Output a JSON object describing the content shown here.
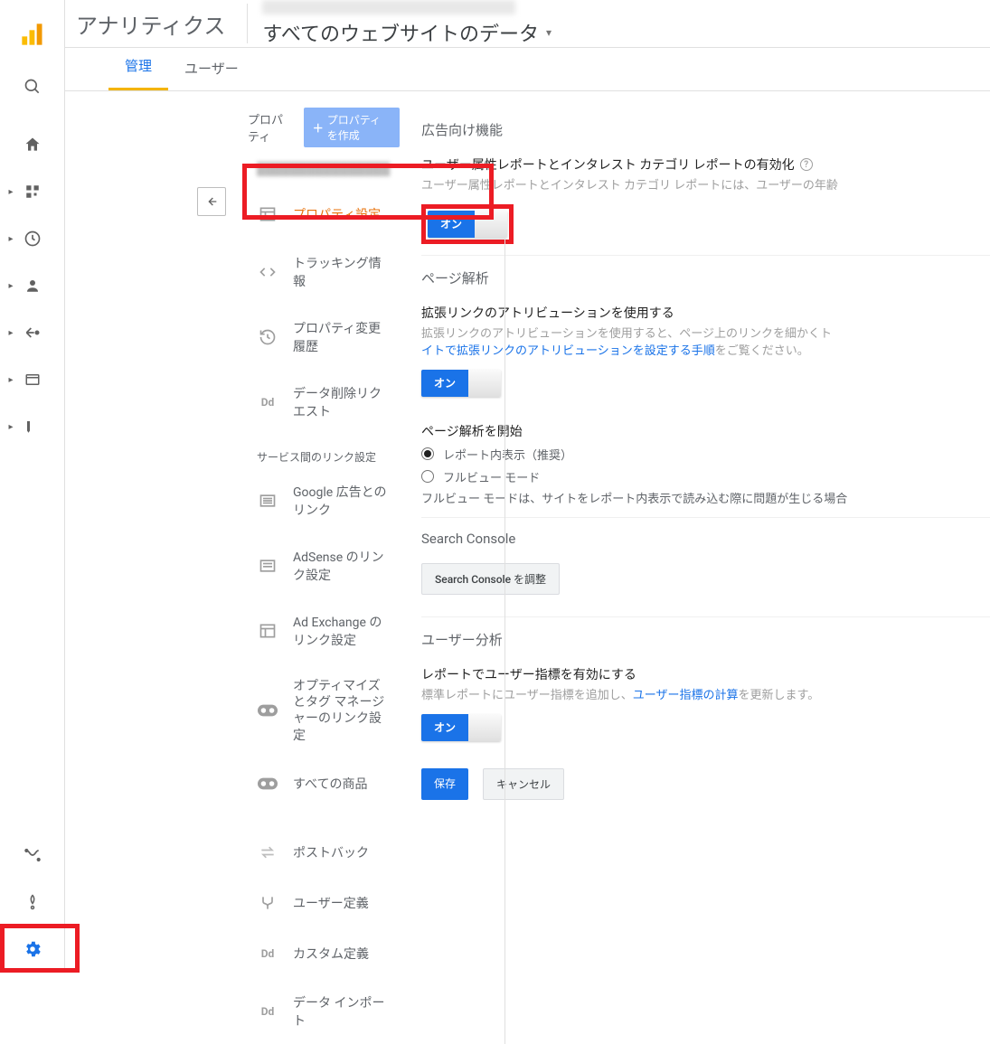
{
  "header": {
    "product": "アナリティクス",
    "view": "すべてのウェブサイトのデータ"
  },
  "tabs": {
    "admin": "管理",
    "user": "ユーザー"
  },
  "column": {
    "title": "プロパティ",
    "create": "プロパティを作成",
    "items": [
      {
        "label": "プロパティ設定"
      },
      {
        "label": "トラッキング情報"
      },
      {
        "label": "プロパティ変更履歴"
      },
      {
        "label": "データ削除リクエスト"
      }
    ],
    "section1": "サービス間のリンク設定",
    "links": [
      {
        "label": "Google 広告とのリンク"
      },
      {
        "label": "AdSense のリンク設定"
      },
      {
        "label": "Ad Exchange のリンク設定"
      },
      {
        "label": "オプティマイズとタグ マネージャーのリンク設定"
      },
      {
        "label": "すべての商品"
      }
    ],
    "extras": [
      {
        "label": "ポストバック"
      },
      {
        "label": "ユーザー定義"
      },
      {
        "label": "カスタム定義"
      },
      {
        "label": "データ インポート"
      }
    ]
  },
  "panel": {
    "adFeatures": "広告向け機能",
    "demographics": {
      "label": "ユーザー属性レポートとインタレスト カテゴリ レポートの有効化",
      "desc": "ユーザー属性レポートとインタレスト カテゴリ レポートには、ユーザーの年齢",
      "toggle": "オン"
    },
    "pageAnalysis": "ページ解析",
    "enhancedLink": {
      "label": "拡張リンクのアトリビューションを使用する",
      "descPrefix": "拡張リンクのアトリビューションを使用すると、ページ上のリンクを細かくト",
      "linkText": "イトで拡張リンクのアトリビューションを設定する手順",
      "descSuffix": "をご覧ください。",
      "toggle": "オン"
    },
    "startAnalysis": {
      "label": "ページ解析を開始",
      "option1": "レポート内表示（推奨）",
      "option2": "フルビュー モード",
      "note": "フルビュー モードは、サイトをレポート内表示で読み込む際に問題が生じる場合"
    },
    "searchConsole": {
      "title": "Search Console",
      "button": "Search Console を調整"
    },
    "userAnalysis": {
      "title": "ユーザー分析",
      "label": "レポートでユーザー指標を有効にする",
      "descPrefix": "標準レポートにユーザー指標を追加し、",
      "linkText": "ユーザー指標の計算",
      "descSuffix": "を更新します。",
      "toggle": "オン"
    },
    "buttons": {
      "save": "保存",
      "cancel": "キャンセル"
    }
  }
}
